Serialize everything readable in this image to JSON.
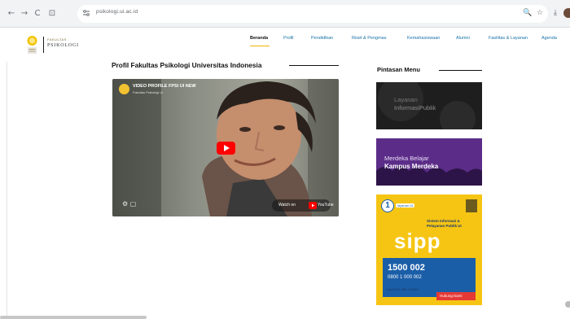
{
  "browser": {
    "url": "psikologi.ui.ac.id",
    "back_glyph": "←",
    "forward_glyph": "→",
    "reload_glyph": "C",
    "home_glyph": "⊡",
    "right_icons": [
      "🔍",
      "☆",
      "⤓"
    ]
  },
  "site": {
    "logo_small": "FAKULTAS",
    "logo_big": "PSIKOLOGI",
    "nav": [
      "Beranda",
      "Profil",
      "Pendidikan",
      "Riset & Pengmas",
      "Kemahasiswaan",
      "Alumni",
      "Fasilitas & Layanan",
      "Agenda"
    ],
    "nav_ids": [
      "beranda",
      "profil",
      "pendidikan",
      "riset-pengmas",
      "kemahasiswaan",
      "alumni",
      "fasilitas-layanan",
      "agenda"
    ]
  },
  "main": {
    "section_title": "Profil Fakultas Psikologi Universitas Indonesia",
    "video": {
      "title": "VIDEO PROFILE FPSI UI NEW",
      "channel": "Fakultas Psikologi UI",
      "watch_on": "Watch on",
      "youtube": "YouTube"
    }
  },
  "sidebar": {
    "title": "Pintasan Menu",
    "banner1": {
      "line1": "Layanan",
      "line2": "InformasiPublik"
    },
    "banner2": {
      "line1": "Merdeka Belajar",
      "line2": "Kampus Merdeka"
    },
    "banner3": {
      "badge": "1",
      "small_badge": "layanan UI",
      "heading": "Sistem Informasi & Pelayanan Publik UI",
      "brand": "sipp",
      "phone1": "1500 002",
      "phone2": "0800 1 000 002",
      "footer1": "Layanan dan Aduan",
      "footer2": "Hubungi kami"
    }
  },
  "colors": {
    "nav_active": "#111111",
    "nav_link": "#1a73a8",
    "accent_underline": "#f0b400",
    "sipp_yellow": "#f6c514",
    "merdeka_purple": "#5f2f8c",
    "youtube_red": "#ff0000"
  }
}
